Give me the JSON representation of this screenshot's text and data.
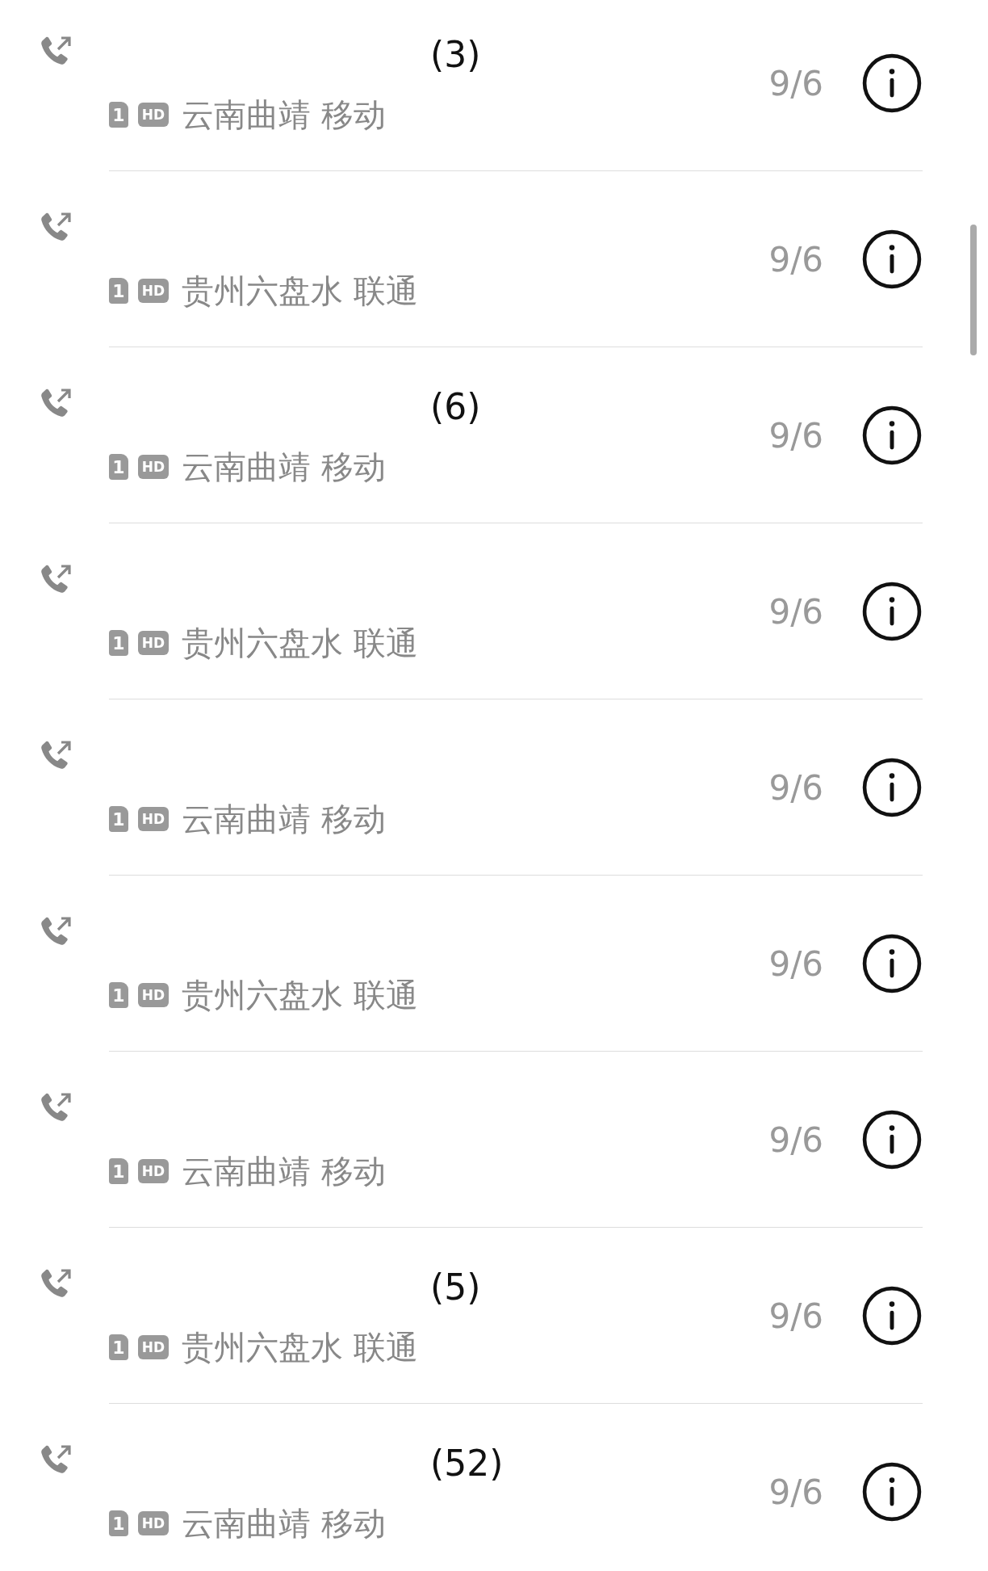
{
  "calls": [
    {
      "kind": "outgoing",
      "count": "(3)",
      "sim": "1",
      "hd": "HD",
      "location": "云南曲靖 移动",
      "date": "9/6"
    },
    {
      "kind": "outgoing",
      "sim": "1",
      "hd": "HD",
      "location": "贵州六盘水 联通",
      "date": "9/6"
    },
    {
      "kind": "outgoing",
      "count": "(6)",
      "sim": "1",
      "hd": "HD",
      "location": "云南曲靖 移动",
      "date": "9/6"
    },
    {
      "kind": "outgoing",
      "sim": "1",
      "hd": "HD",
      "location": "贵州六盘水 联通",
      "date": "9/6"
    },
    {
      "kind": "outgoing",
      "sim": "1",
      "hd": "HD",
      "location": "云南曲靖 移动",
      "date": "9/6"
    },
    {
      "kind": "outgoing",
      "sim": "1",
      "hd": "HD",
      "location": "贵州六盘水 联通",
      "date": "9/6"
    },
    {
      "kind": "outgoing",
      "sim": "1",
      "hd": "HD",
      "location": "云南曲靖 移动",
      "date": "9/6"
    },
    {
      "kind": "outgoing",
      "count": "(5)",
      "sim": "1",
      "hd": "HD",
      "location": "贵州六盘水 联通",
      "date": "9/6"
    },
    {
      "kind": "outgoing",
      "count": "(52)",
      "sim": "1",
      "hd": "HD",
      "location": "云南曲靖 移动",
      "date": "9/6"
    }
  ]
}
